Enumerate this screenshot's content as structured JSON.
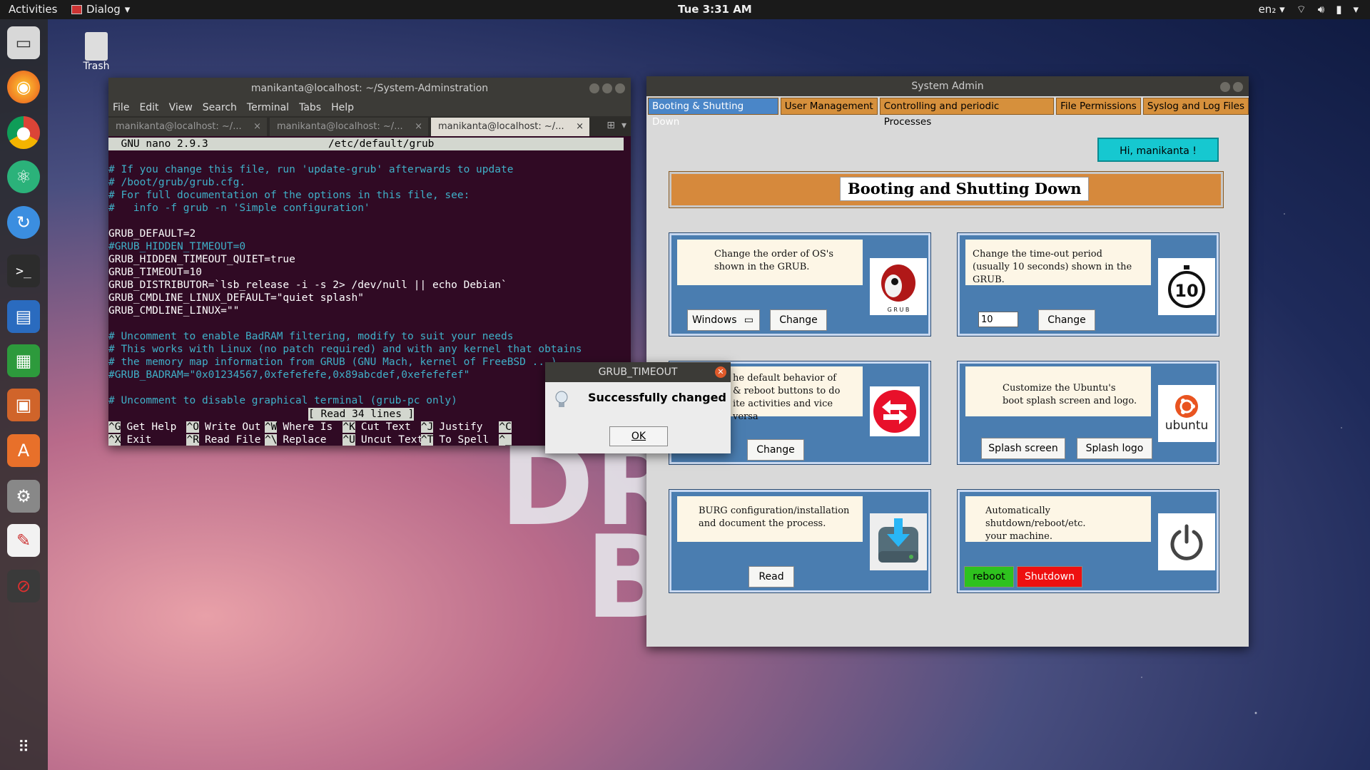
{
  "topbar": {
    "activities": "Activities",
    "app_name": "Dialog",
    "clock": "Tue  3:31 AM",
    "lang": "en₂"
  },
  "desktop": {
    "trash_label": "Trash",
    "bg_letters_1": "DR",
    "bg_letters_2": "B"
  },
  "terminal": {
    "title": "manikanta@localhost: ~/System-Adminstration",
    "menu": [
      "File",
      "Edit",
      "View",
      "Search",
      "Terminal",
      "Tabs",
      "Help"
    ],
    "tabs": [
      "manikanta@localhost: ~/...",
      "manikanta@localhost: ~/...",
      "manikanta@localhost: ~/..."
    ],
    "nano_version": "  GNU nano 2.9.3",
    "nano_file": "/etc/default/grub",
    "lines": [
      {
        "t": "# If you change this file, run 'update-grub' afterwards to update",
        "c": "cmt"
      },
      {
        "t": "# /boot/grub/grub.cfg.",
        "c": "cmt"
      },
      {
        "t": "# For full documentation of the options in this file, see:",
        "c": "cmt"
      },
      {
        "t": "#   info -f grub -n 'Simple configuration'",
        "c": "cmt"
      },
      {
        "t": " ",
        "c": "plain"
      },
      {
        "t": "GRUB_DEFAULT=2",
        "c": "plain"
      },
      {
        "t": "#GRUB_HIDDEN_TIMEOUT=0",
        "c": "cmt"
      },
      {
        "t": "GRUB_HIDDEN_TIMEOUT_QUIET=true",
        "c": "plain"
      },
      {
        "t": "GRUB_TIMEOUT=10",
        "c": "plain"
      },
      {
        "t": "GRUB_DISTRIBUTOR=`lsb_release -i -s 2> /dev/null || echo Debian`",
        "c": "plain"
      },
      {
        "t": "GRUB_CMDLINE_LINUX_DEFAULT=\"quiet splash\"",
        "c": "plain"
      },
      {
        "t": "GRUB_CMDLINE_LINUX=\"\"",
        "c": "plain"
      },
      {
        "t": " ",
        "c": "plain"
      },
      {
        "t": "# Uncomment to enable BadRAM filtering, modify to suit your needs",
        "c": "cmt"
      },
      {
        "t": "# This works with Linux (no patch required) and with any kernel that obtains",
        "c": "cmt"
      },
      {
        "t": "# the memory map information from GRUB (GNU Mach, kernel of FreeBSD ...)",
        "c": "cmt"
      },
      {
        "t": "#GRUB_BADRAM=\"0x01234567,0xfefefefe,0x89abcdef,0xefefefef\"",
        "c": "cmt"
      },
      {
        "t": " ",
        "c": "plain"
      },
      {
        "t": "# Uncomment to disable graphical terminal (grub-pc only)",
        "c": "cmt"
      }
    ],
    "status": "[ Read 34 lines ]",
    "shortcuts_row1": [
      [
        "^G",
        "Get Help"
      ],
      [
        "^O",
        "Write Out"
      ],
      [
        "^W",
        "Where Is"
      ],
      [
        "^K",
        "Cut Text"
      ],
      [
        "^J",
        "Justify"
      ],
      [
        "^C",
        ""
      ]
    ],
    "shortcuts_row2": [
      [
        "^X",
        "Exit"
      ],
      [
        "^R",
        "Read File"
      ],
      [
        "^\\",
        "Replace"
      ],
      [
        "^U",
        "Uncut Text"
      ],
      [
        "^T",
        "To Spell"
      ],
      [
        "^_",
        ""
      ]
    ]
  },
  "sysadmin": {
    "title": "System Admin",
    "tabs": [
      "Booting & Shutting Down",
      "User Management",
      "Controlling and periodic Processes",
      "File Permissions",
      "Syslog and Log Files"
    ],
    "greeting": "Hi, manikanta !",
    "banner": "Booting and Shutting Down",
    "cards": {
      "order": {
        "line1": "Change the order of OS's",
        "line2": "shown in the GRUB.",
        "select_value": "Windows",
        "button": "Change",
        "logo_text": "G R U B"
      },
      "timeout": {
        "line1": "Change the time-out period",
        "line2": "(usually 10 seconds) shown in the GRUB.",
        "input_value": "10",
        "button": "Change",
        "icon_text": "10"
      },
      "behavior": {
        "line1": "he default behavior of",
        "line2": "& reboot buttons to do",
        "line3": "ite activities and vice versa",
        "button": "Change"
      },
      "splash": {
        "line1": "Customize the Ubuntu's",
        "line2": "boot splash screen and logo.",
        "button1": "Splash screen",
        "button2": "Splash logo",
        "logo_text": "ubuntu"
      },
      "burg": {
        "line1": "BURG configuration/installation",
        "line2": "and document the process.",
        "button": "Read"
      },
      "power": {
        "line1": "Automatically shutdown/reboot/etc.",
        "line2": "your machine.",
        "button_reboot": "reboot",
        "button_shutdown": "Shutdown"
      }
    }
  },
  "dialog": {
    "title": "GRUB_TIMEOUT",
    "message": "Successfully changed",
    "ok": "OK"
  },
  "colors": {
    "reboot_bg": "#2ec21e",
    "shutdown_bg": "#ee1010",
    "card_bg": "#4a7db0",
    "tab_bg": "#d6903c"
  }
}
